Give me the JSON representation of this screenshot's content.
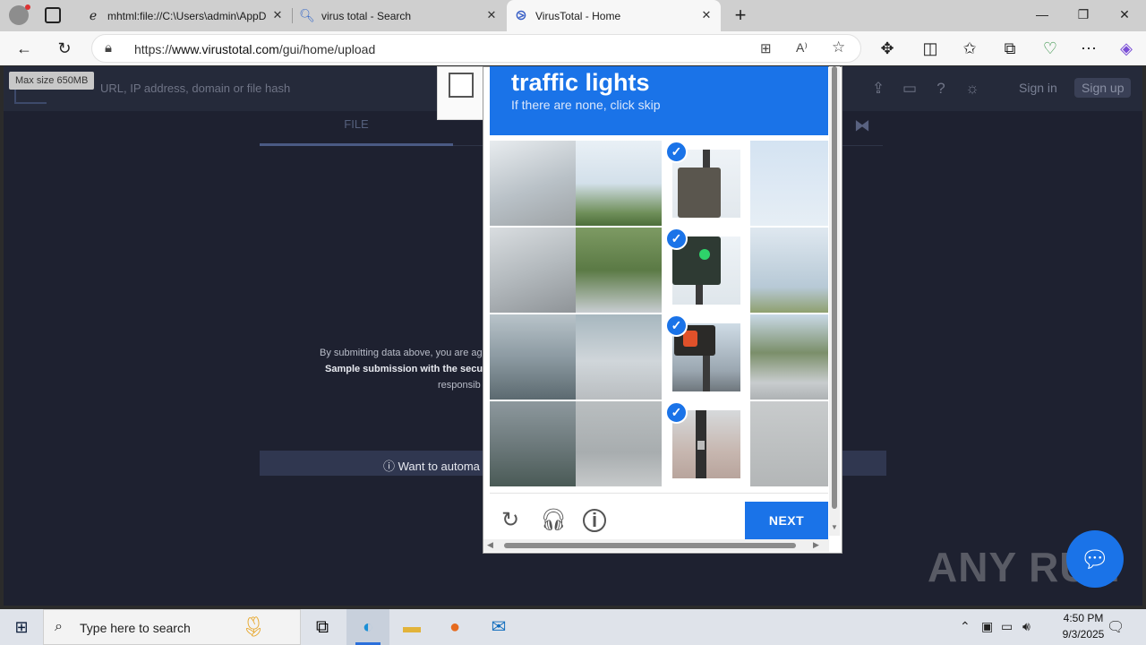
{
  "browser": {
    "tabs": [
      {
        "title": "mhtml:file://C:\\Users\\admin\\AppD",
        "icon": "ie-icon"
      },
      {
        "title": "virus total - Search",
        "icon": "search-icon"
      },
      {
        "title": "VirusTotal - Home",
        "icon": "virustotal-icon",
        "active": true
      }
    ],
    "url": "https://www.virustotal.com/gui/home/upload",
    "url_prefix": "https://",
    "url_host": "www.virustotal.com",
    "url_path": "/gui/home/upload"
  },
  "virustotal": {
    "max_size": "Max size 650MB",
    "search_placeholder": "URL, IP address, domain or file hash",
    "sign_in": "Sign in",
    "sign_up": "Sign up",
    "tab_file": "FILE",
    "terms_line1": "By submitting data above, you are ag",
    "terms_line2": "Sample submission with the secu",
    "terms_line3": "responsib",
    "automate_text": "Want to automa"
  },
  "captcha": {
    "title": "traffic lights",
    "subtitle": "If there are none, click skip",
    "next_label": "NEXT",
    "accent": "#1a73e8",
    "selected_tiles": [
      {
        "row": 1,
        "col": 3
      },
      {
        "row": 2,
        "col": 3
      },
      {
        "row": 3,
        "col": 3
      },
      {
        "row": 4,
        "col": 3
      }
    ]
  },
  "watermark": "ANY RUN",
  "taskbar": {
    "search_placeholder": "Type here to search",
    "time": "4:50 PM",
    "date": "9/3/2025"
  }
}
